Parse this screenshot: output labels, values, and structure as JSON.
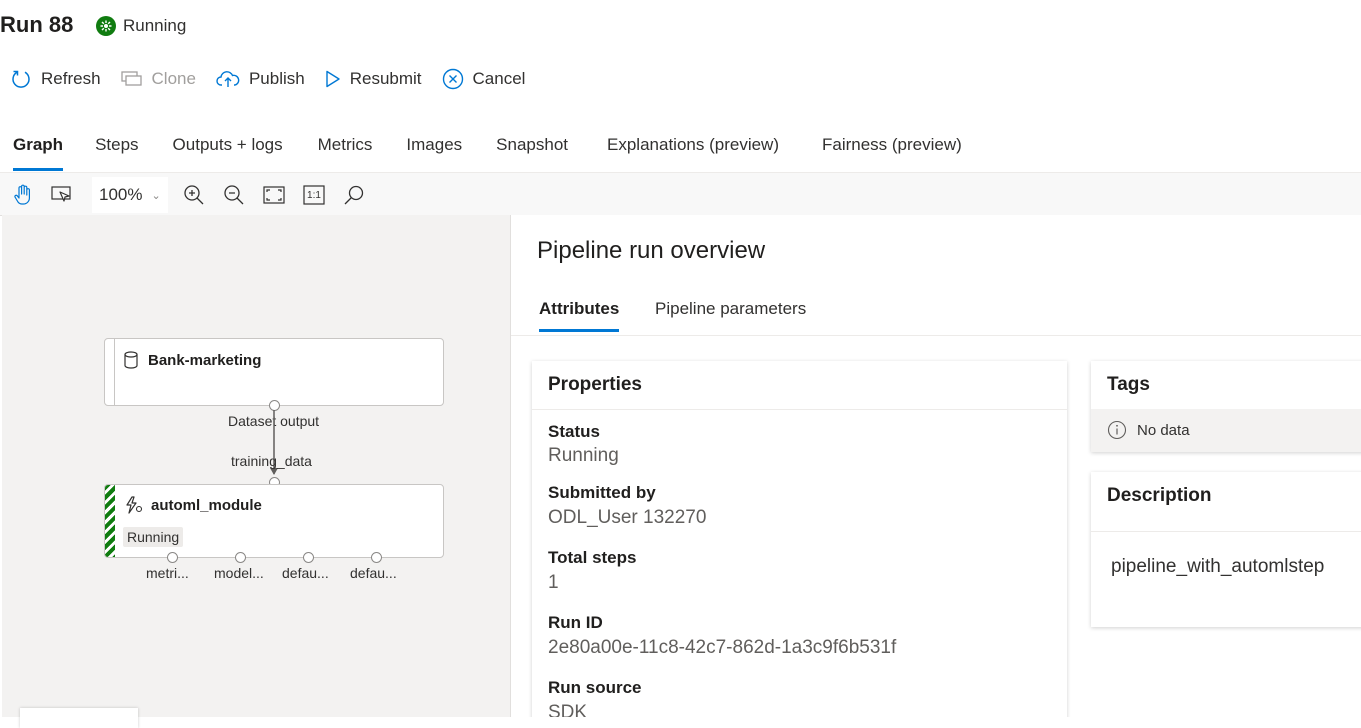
{
  "header": {
    "title": "Run 88",
    "status": "Running",
    "status_color": "#107c10"
  },
  "commands": {
    "refresh": "Refresh",
    "clone": "Clone",
    "publish": "Publish",
    "resubmit": "Resubmit",
    "cancel": "Cancel"
  },
  "tabs": [
    {
      "label": "Graph",
      "active": true
    },
    {
      "label": "Steps"
    },
    {
      "label": "Outputs + logs"
    },
    {
      "label": "Metrics"
    },
    {
      "label": "Images"
    },
    {
      "label": "Snapshot"
    },
    {
      "label": "Explanations (preview)"
    },
    {
      "label": "Fairness (preview)"
    }
  ],
  "graph_toolbar": {
    "zoom": "100%",
    "icons": [
      "hand-pan-icon",
      "select-pointer-icon",
      "zoom-in-icon",
      "zoom-out-icon",
      "fit-to-screen-icon",
      "actual-size-icon",
      "search-icon"
    ],
    "actual_size_label": "1:1"
  },
  "graph": {
    "dataset_node": {
      "title": "Bank-marketing",
      "output_label": "Dataset output"
    },
    "edge_label": "training_data",
    "module_node": {
      "title": "automl_module",
      "status": "Running",
      "outputs": [
        "metri...",
        "model...",
        "defau...",
        "defau..."
      ]
    }
  },
  "panel": {
    "title": "Pipeline run overview",
    "tabs": [
      "Attributes",
      "Pipeline parameters"
    ],
    "accent_color": "#0078d4",
    "properties": {
      "title": "Properties",
      "status_label": "Status",
      "status_value": "Running",
      "submitted_by_label": "Submitted by",
      "submitted_by_value": "ODL_User 132270",
      "total_steps_label": "Total steps",
      "total_steps_value": "1",
      "run_id_label": "Run ID",
      "run_id_value": "2e80a00e-11c8-42c7-862d-1a3c9f6b531f",
      "run_source_label": "Run source",
      "run_source_value": "SDK"
    },
    "tags": {
      "title": "Tags",
      "empty": "No data"
    },
    "description": {
      "title": "Description",
      "text": "pipeline_with_automlstep"
    }
  }
}
